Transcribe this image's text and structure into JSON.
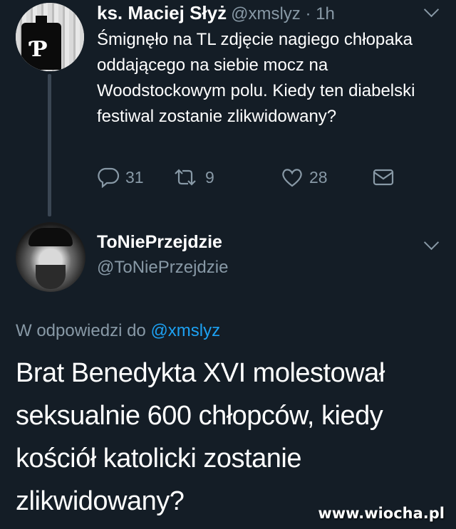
{
  "tweet1": {
    "author_name": "ks. Maciej Słyż",
    "author_handle": "@xmslyz · 1h",
    "text": "Śmignęło na TL zdjęcie nagiego chłopaka oddającego na siebie mocz na Woodstockowym polu. Kiedy ten diabelski festiwal zostanie zlikwidowany?",
    "replies": "31",
    "retweets": "9",
    "likes": "28",
    "avatar_icon": "fighting-poland-anchor-icon"
  },
  "tweet2": {
    "author_name": "ToNiePrzejdzie",
    "author_handle": "@ToNiePrzejdzie",
    "replying_prefix": "W odpowiedzi do",
    "replying_to": "@xmslyz",
    "text": "Brat Benedykta XVI molestował seksualnie 600 chłopców, kiedy kościół katolicki zostanie zlikwidowany?"
  },
  "watermark": "www.wiocha.pl",
  "colors": {
    "background": "#141d26",
    "text": "#ffffff",
    "secondary": "#8899a6",
    "link": "#1da1f2"
  }
}
